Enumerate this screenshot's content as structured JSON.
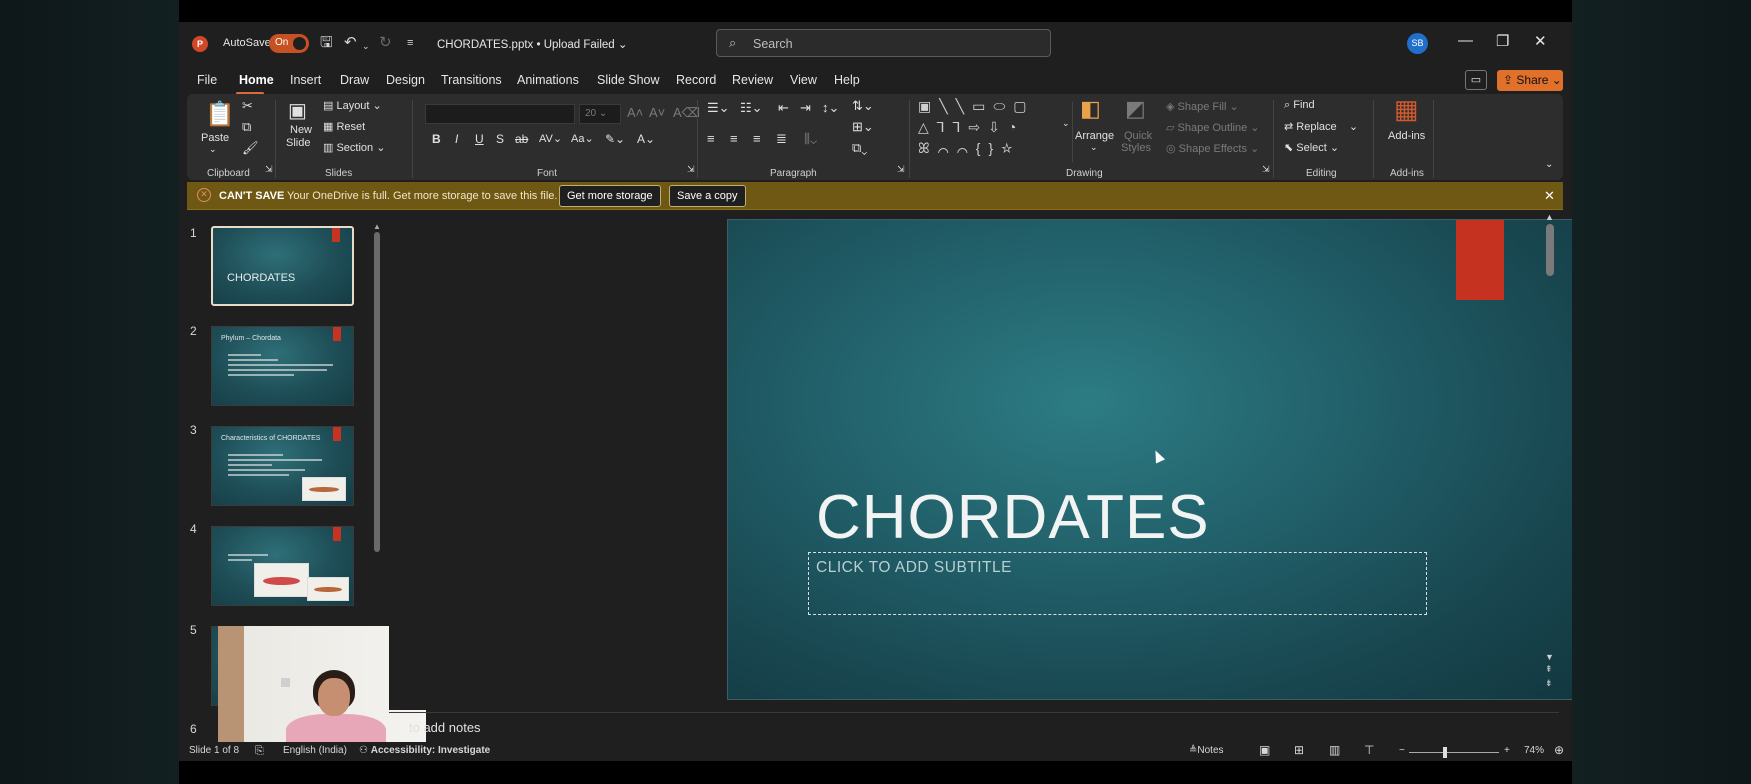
{
  "titlebar": {
    "autosave_label": "AutoSave",
    "autosave_state": "On",
    "document": "CHORDATES.pptx",
    "upload_status": "• Upload Failed ⌄",
    "search_placeholder": "Search",
    "user_initials": "SB"
  },
  "menu": {
    "tabs": [
      "File",
      "Home",
      "Insert",
      "Draw",
      "Design",
      "Transitions",
      "Animations",
      "Slide Show",
      "Record",
      "Review",
      "View",
      "Help"
    ],
    "active": "Home",
    "share_label": "Share"
  },
  "ribbon": {
    "clipboard": {
      "paste": "Paste",
      "group": "Clipboard"
    },
    "slides": {
      "new_slide": "New",
      "new_slide2": "Slide",
      "layout": "Layout",
      "reset": "Reset",
      "section": "Section",
      "group": "Slides"
    },
    "font": {
      "size": "20",
      "group": "Font"
    },
    "paragraph": {
      "group": "Paragraph"
    },
    "drawing": {
      "arrange": "Arrange",
      "quick_styles": "Quick",
      "quick_styles2": "Styles",
      "shape_fill": "Shape Fill",
      "shape_outline": "Shape Outline",
      "shape_effects": "Shape Effects",
      "group": "Drawing"
    },
    "editing": {
      "find": "Find",
      "replace": "Replace",
      "select": "Select",
      "group": "Editing"
    },
    "addins": {
      "label": "Add-ins",
      "group": "Add-ins"
    }
  },
  "notification": {
    "title": "CAN'T SAVE",
    "message": "Your OneDrive is full. Get more storage to save this file.",
    "button_storage": "Get more storage",
    "button_copy": "Save a copy"
  },
  "thumbnails": {
    "numbers": [
      "1",
      "2",
      "3",
      "4",
      "5",
      "6"
    ],
    "slide1_title": "CHORDATES",
    "slide2_title": "Phylum – Chordata",
    "slide3_title": "Characteristics of CHORDATES"
  },
  "slide": {
    "title": "CHORDATES",
    "subtitle_placeholder": "CLICK TO ADD SUBTITLE"
  },
  "notes": {
    "placeholder": "to add notes"
  },
  "status": {
    "slide_counter": "Slide 1 of 8",
    "language": "English (India)",
    "accessibility": "Accessibility: Investigate",
    "notes_label": "Notes",
    "zoom": "74%"
  },
  "colors": {
    "accent_orange": "#e0702a",
    "warning_bar": "#6e5814",
    "slide_teal": "#215f69",
    "slide_red_tag": "#c5321f"
  }
}
